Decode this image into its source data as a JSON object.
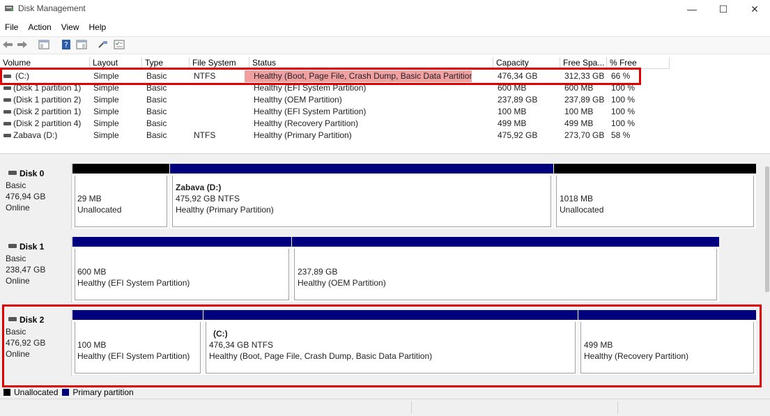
{
  "window": {
    "title": "Disk Management",
    "minimize": "—",
    "maximize": "☐",
    "close": "✕"
  },
  "menu": [
    "File",
    "Action",
    "View",
    "Help"
  ],
  "columns": [
    "Volume",
    "Layout",
    "Type",
    "File System",
    "Status",
    "Capacity",
    "Free Spa...",
    "% Free"
  ],
  "volumes": [
    {
      "volume": "(C:)",
      "layout": "Simple",
      "type": "Basic",
      "fs": "NTFS",
      "status": "Healthy (Boot, Page File, Crash Dump, Basic Data Partition)",
      "capacity": "476,34 GB",
      "free": "312,33 GB",
      "pct": "66 %"
    },
    {
      "volume": "(Disk 1 partition 1)",
      "layout": "Simple",
      "type": "Basic",
      "fs": "",
      "status": "Healthy (EFI System Partition)",
      "capacity": "600 MB",
      "free": "600 MB",
      "pct": "100 %"
    },
    {
      "volume": "(Disk 1 partition 2)",
      "layout": "Simple",
      "type": "Basic",
      "fs": "",
      "status": "Healthy (OEM Partition)",
      "capacity": "237,89 GB",
      "free": "237,89 GB",
      "pct": "100 %"
    },
    {
      "volume": "(Disk 2 partition 1)",
      "layout": "Simple",
      "type": "Basic",
      "fs": "",
      "status": "Healthy (EFI System Partition)",
      "capacity": "100 MB",
      "free": "100 MB",
      "pct": "100 %"
    },
    {
      "volume": "(Disk 2 partition 4)",
      "layout": "Simple",
      "type": "Basic",
      "fs": "",
      "status": "Healthy (Recovery Partition)",
      "capacity": "499 MB",
      "free": "499 MB",
      "pct": "100 %"
    },
    {
      "volume": "Zabava (D:)",
      "layout": "Simple",
      "type": "Basic",
      "fs": "NTFS",
      "status": "Healthy (Primary Partition)",
      "capacity": "475,92 GB",
      "free": "273,70 GB",
      "pct": "58 %"
    }
  ],
  "disks": [
    {
      "name": "Disk 0",
      "kind": "Basic",
      "size": "476,94 GB",
      "state": "Online",
      "partitions": [
        {
          "title": "",
          "line1": "29 MB",
          "line2": "Unallocated",
          "kind": "unallocated"
        },
        {
          "title": "Zabava  (D:)",
          "line1": "475,92 GB NTFS",
          "line2": "Healthy (Primary Partition)",
          "kind": "primary"
        },
        {
          "title": "",
          "line1": "1018 MB",
          "line2": "Unallocated",
          "kind": "unallocated"
        }
      ]
    },
    {
      "name": "Disk 1",
      "kind": "Basic",
      "size": "238,47 GB",
      "state": "Online",
      "partitions": [
        {
          "title": "",
          "line1": "600 MB",
          "line2": "Healthy (EFI System Partition)",
          "kind": "primary"
        },
        {
          "title": "",
          "line1": "237,89 GB",
          "line2": "Healthy (OEM Partition)",
          "kind": "primary"
        }
      ]
    },
    {
      "name": "Disk 2",
      "kind": "Basic",
      "size": "476,92 GB",
      "state": "Online",
      "partitions": [
        {
          "title": "",
          "line1": "100 MB",
          "line2": "Healthy (EFI System Partition)",
          "kind": "primary"
        },
        {
          "title": "(C:)",
          "line1": "476,34 GB NTFS",
          "line2": "Healthy (Boot, Page File, Crash Dump, Basic Data Partition)",
          "kind": "primary"
        },
        {
          "title": "",
          "line1": "499 MB",
          "line2": "Healthy (Recovery Partition)",
          "kind": "primary"
        }
      ]
    }
  ],
  "legend": [
    {
      "label": "Unallocated",
      "color": "#000000"
    },
    {
      "label": "Primary partition",
      "color": "#00007f"
    }
  ],
  "colors": {
    "primary": "#00007f",
    "unallocated": "#000000",
    "highlight": "#e00000",
    "status_highlight": "#f0a0a0"
  }
}
